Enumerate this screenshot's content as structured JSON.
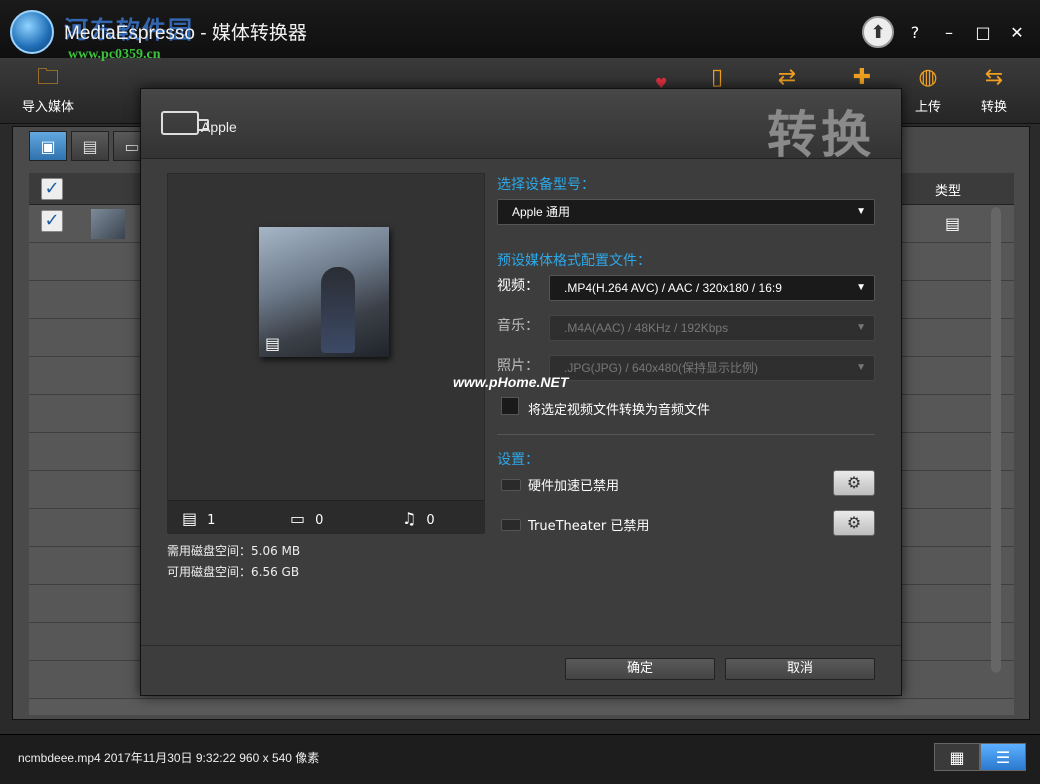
{
  "window": {
    "title": "MediaEspresso - 媒体转换器",
    "watermark_site": "河东软件园",
    "watermark_url": "www.pc0359.cn",
    "help": "?",
    "minimize": "–",
    "maximize": "□",
    "close": "✕"
  },
  "toolbar": {
    "import_label": "导入媒体",
    "upload_label": "上传",
    "convert_label": "转换"
  },
  "list": {
    "header_type": "类型"
  },
  "dialog": {
    "device": "Apple",
    "title": "转换",
    "device_model_label": "选择设备型号：",
    "device_model_value": "Apple 通用",
    "preset_label": "预设媒体格式配置文件：",
    "video_label": "视频：",
    "video_value": ".MP4(H.264 AVC) / AAC / 320x180 / 16:9",
    "music_label": "音乐：",
    "music_value": ".M4A(AAC) / 48KHz / 192Kbps",
    "photo_label": "照片：",
    "photo_value": ".JPG(JPG) / 640x480(保持显示比例)",
    "convert_to_audio": "将选定视频文件转换为音频文件",
    "settings_label": "设置：",
    "hw_accel": "硬件加速已禁用",
    "truetheater": "TrueTheater 已禁用",
    "video_count": "1",
    "photo_count": "0",
    "music_count": "0",
    "disk_required": "需用磁盘空间：5.06 MB",
    "disk_available": "可用磁盘空间：6.56 GB",
    "ok_button": "确定",
    "cancel_button": "取消",
    "watermark": "www.pHome.NET"
  },
  "statusbar": {
    "file_info": "ncmbdeee.mp4   2017年11月30日 9:32:22 960 x 540 像素"
  },
  "colors": {
    "accent_blue": "#2da8e8",
    "toolbar_icon": "#f0a020"
  }
}
